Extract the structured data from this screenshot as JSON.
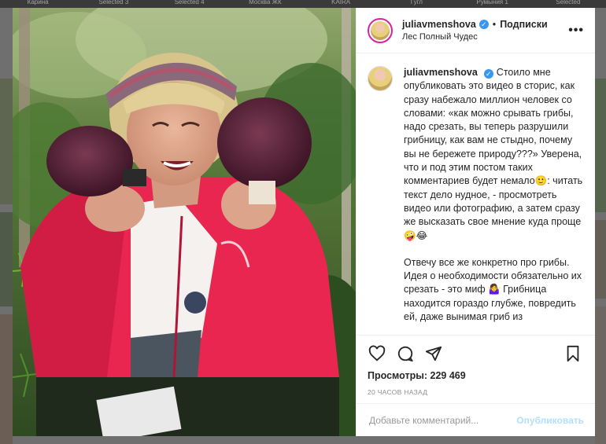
{
  "background": {
    "tabs": [
      "Карина",
      "Selected 3",
      "Selected 4",
      "Москва ЖК",
      "KAIRA",
      "Гугл",
      "Румыния 1",
      "Selected"
    ]
  },
  "post": {
    "username": "juliavmenshova",
    "verified_icon": "verified-badge-icon",
    "dot": "•",
    "follow_label": "Подписки",
    "location": "Лес Полный Чудес",
    "more_icon": "more-options-icon",
    "caption": {
      "paragraph1": "Стоило мне опубликовать это видео в сторис, как сразу набежало миллион человек со словами: «как можно срывать грибы, надо срезать, вы теперь разрушили грибницу, как вам не стыдно, почему вы не бережете природу???» Уверена, что и под этим постом таких комментариев будет немало🙂: читать текст дело нудное, - просмотреть видео или фотографию, а затем сразу же высказать свое мнение куда проще 🤪😂",
      "paragraph2": "Отвечу все же конкретно про грибы. Идея о необходимости обязательно их срезать - это миф 🤷‍♀️ Грибница находится гораздо глубже, повредить ей, даже вынимая гриб из"
    },
    "views_label": "Просмотры:",
    "views_count": "229 469",
    "time_ago": "20 ЧАСОВ НАЗАД",
    "comment_placeholder": "Добавьте комментарий...",
    "publish_label": "Опубликовать",
    "colors": {
      "accent": "#3897f0",
      "publish_disabled": "#b2dffc",
      "jacket": "#e8264f"
    }
  }
}
